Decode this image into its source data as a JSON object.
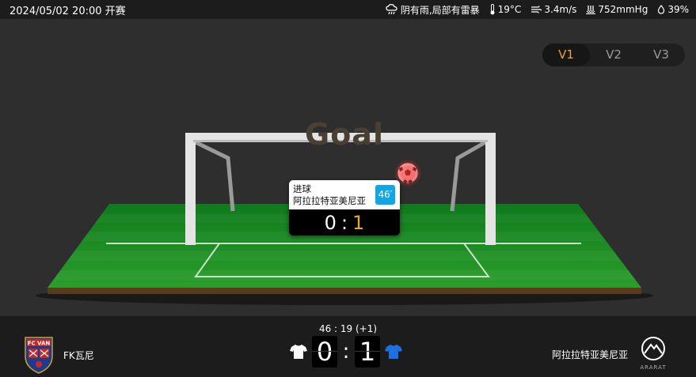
{
  "topbar": {
    "match_time": "2024/05/02 20:00 开赛",
    "weather": {
      "condition": "阴有雨,局部有雷暴",
      "temperature": "19°C",
      "wind": "3.4m/s",
      "pressure": "752mmHg",
      "humidity": "39%"
    }
  },
  "tabs": [
    {
      "label": "V1",
      "active": true
    },
    {
      "label": "V2",
      "active": false
    },
    {
      "label": "V3",
      "active": false
    }
  ],
  "stage": {
    "banner": "Goal",
    "event": {
      "type": "进球",
      "team": "阿拉拉特亚美尼亚",
      "minute": "46′",
      "home_score": "0",
      "away_score": "1"
    }
  },
  "match": {
    "clock": "46 : 19  (+1)",
    "home": {
      "name": "FK瓦尼",
      "score": "0",
      "kit_color": "#ffffff"
    },
    "away": {
      "name": "阿拉拉特亚美尼亚",
      "score": "1",
      "kit_color": "#1e6fe0"
    }
  },
  "colors": {
    "accent": "#e8a531",
    "badge": "#12a7e3"
  }
}
